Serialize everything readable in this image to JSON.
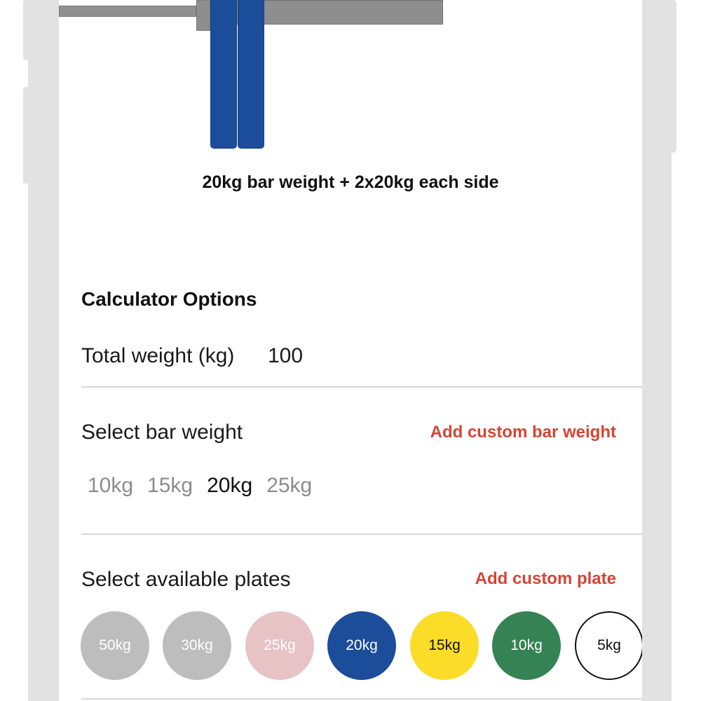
{
  "barbell": {
    "summary": "20kg bar weight + 2x20kg each side",
    "plate_color": "#1c4d9a"
  },
  "options": {
    "title": "Calculator Options",
    "total_weight_label": "Total weight (kg)",
    "total_weight_value": "100",
    "bar_weight_label": "Select bar weight",
    "add_custom_bar_label": "Add custom bar weight",
    "bar_weights": [
      {
        "label": "10kg",
        "selected": false
      },
      {
        "label": "15kg",
        "selected": false
      },
      {
        "label": "20kg",
        "selected": true
      },
      {
        "label": "25kg",
        "selected": false
      }
    ],
    "plates_label": "Select available plates",
    "add_custom_plate_label": "Add custom plate",
    "plates": [
      {
        "label": "50kg",
        "color": "#bdbdbd",
        "text_color": "#ffffff",
        "active": false
      },
      {
        "label": "30kg",
        "color": "#bdbdbd",
        "text_color": "#ffffff",
        "active": false
      },
      {
        "label": "25kg",
        "color": "#e7c3c6",
        "text_color": "#ffffff",
        "active": false
      },
      {
        "label": "20kg",
        "color": "#1c4d9a",
        "text_color": "#ffffff",
        "active": true
      },
      {
        "label": "15kg",
        "color": "#fbdd29",
        "text_color": "#111111",
        "active": true
      },
      {
        "label": "10kg",
        "color": "#358354",
        "text_color": "#ffffff",
        "active": true
      },
      {
        "label": "5kg",
        "color": "#ffffff",
        "text_color": "#111111",
        "active": true
      }
    ]
  },
  "colors": {
    "accent": "#d44535",
    "frame": "#e2e2e2"
  }
}
